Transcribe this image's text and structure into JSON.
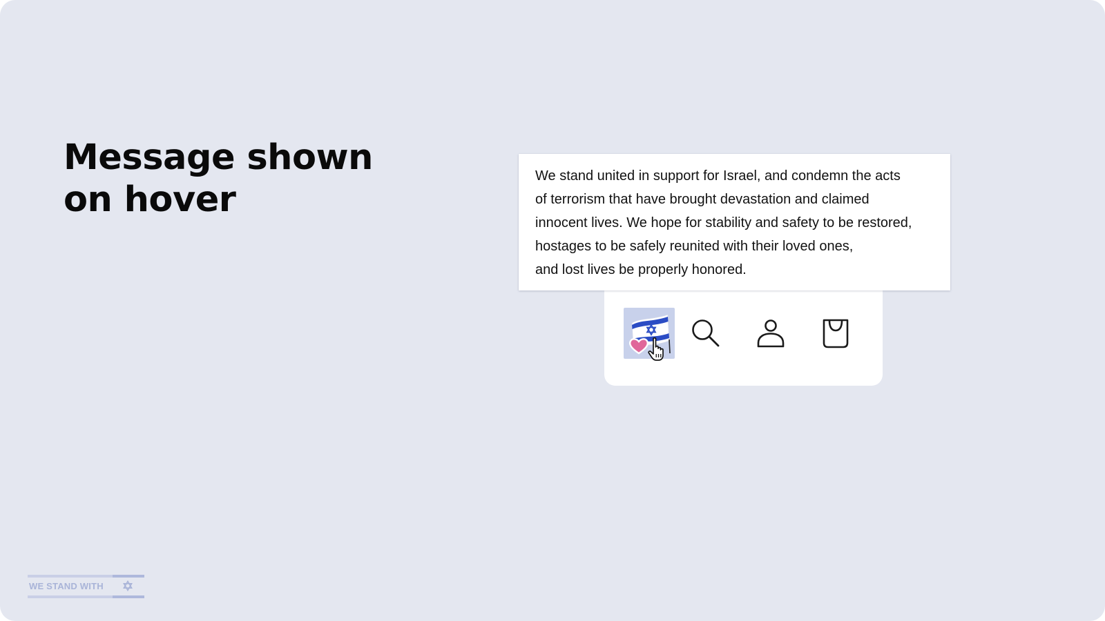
{
  "heading": {
    "line1": "Message shown",
    "line2": "on hover"
  },
  "tooltip": {
    "lines": [
      "We stand united in support for Israel, and condemn the acts",
      "of terrorism that have brought devastation and claimed",
      "innocent lives. We hope for stability and safety to be restored,",
      "hostages to be safely reunited with their loved ones,",
      "and lost lives be properly honored."
    ]
  },
  "navbar": {
    "items": [
      {
        "icon": "israel-flag-heart-icon",
        "state": "hovered"
      },
      {
        "icon": "search-icon"
      },
      {
        "icon": "user-icon"
      },
      {
        "icon": "shopping-bag-icon"
      }
    ]
  },
  "badge": {
    "text": "WE STAND WITH",
    "icon": "star-of-david-icon"
  },
  "colors": {
    "background": "#e4e7f0",
    "flag_blue": "#2b4cc4",
    "heart_pink": "#e0679a",
    "hover_bg": "#c8d1eb",
    "badge_text": "#a9b4d8"
  }
}
